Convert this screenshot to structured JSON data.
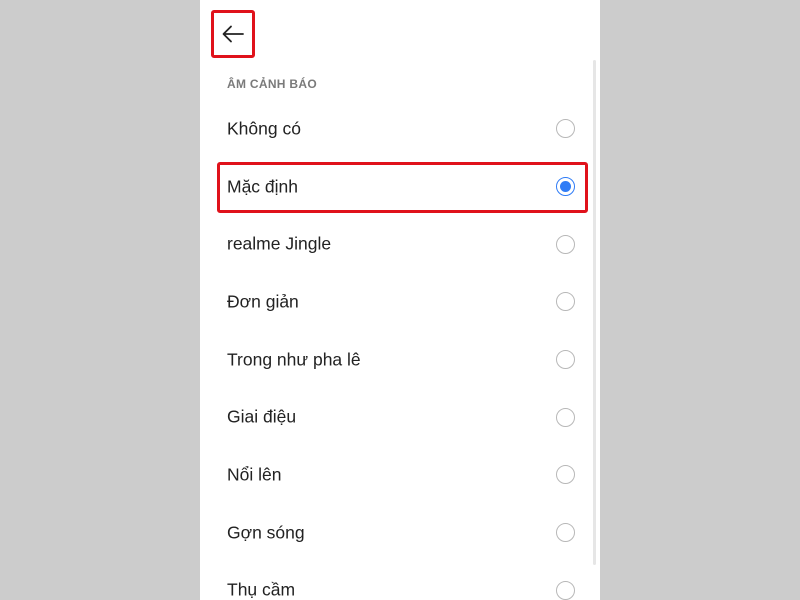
{
  "header": {
    "back_icon": "arrow-left-icon"
  },
  "section": {
    "title": "ÂM CẢNH BÁO"
  },
  "colors": {
    "accent": "#2f7cf6",
    "annotation_red": "#e0121b",
    "background_outer": "#cccccc"
  },
  "options": [
    {
      "label": "Không có",
      "selected": false
    },
    {
      "label": "Mặc định",
      "selected": true
    },
    {
      "label": "realme Jingle",
      "selected": false
    },
    {
      "label": "Đơn giản",
      "selected": false
    },
    {
      "label": "Trong như pha lê",
      "selected": false
    },
    {
      "label": "Giai điệu",
      "selected": false
    },
    {
      "label": "Nổi lên",
      "selected": false
    },
    {
      "label": "Gợn sóng",
      "selected": false
    },
    {
      "label": "Thụ cầm",
      "selected": false
    }
  ]
}
